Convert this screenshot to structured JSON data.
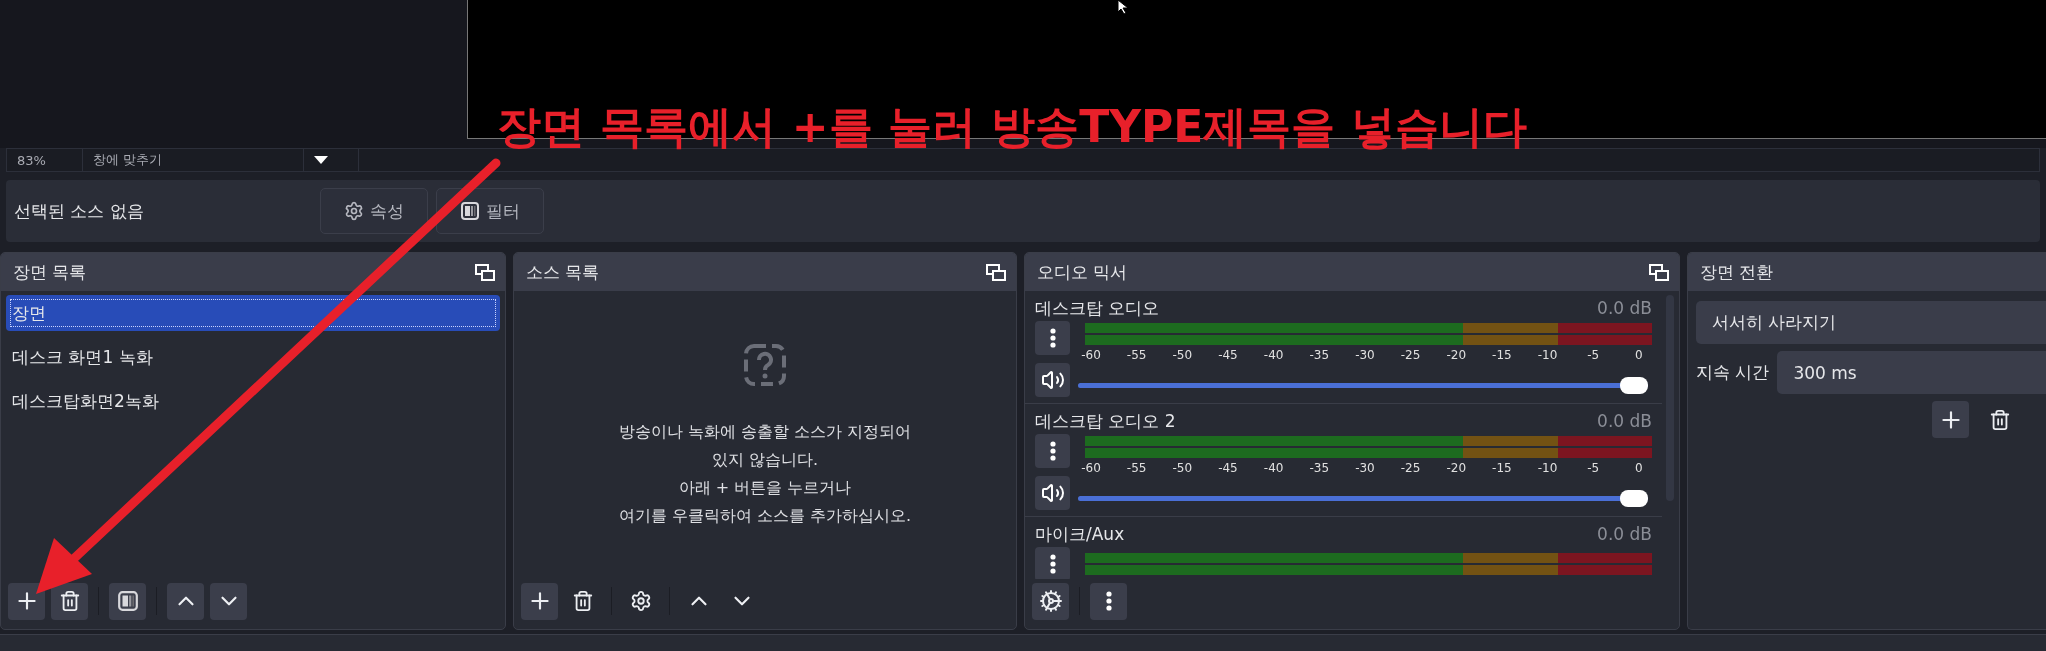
{
  "preview": {
    "zoom": "83%",
    "scale_mode": "창에 맞추기"
  },
  "annotation": {
    "text": "장면 목록에서 +를 눌러 방송TYPE제목을 넣습니다"
  },
  "context_bar": {
    "status": "선택된 소스 없음",
    "buttons": [
      "속성",
      "필터"
    ]
  },
  "scenes": {
    "title": "장면 목록",
    "items": [
      {
        "label": "장면",
        "selected": true
      },
      {
        "label": "데스크 화면1 녹화",
        "selected": false
      },
      {
        "label": "데스크탑화면2녹화",
        "selected": false
      }
    ]
  },
  "sources": {
    "title": "소스 목록",
    "empty_lines": [
      "방송이나 녹화에 송출할 소스가 지정되어",
      "있지 않습니다.",
      "아래 + 버튼을 누르거나",
      "여기를 우클릭하여 소스를 추가하십시오."
    ]
  },
  "audio_mixer": {
    "title": "오디오 믹서",
    "channels": [
      {
        "name": "데스크탑 오디오",
        "reading": "0.0 dB",
        "scale": [
          "-60",
          "-55",
          "-50",
          "-45",
          "-40",
          "-35",
          "-30",
          "-25",
          "-20",
          "-15",
          "-10",
          "-5",
          "0"
        ],
        "level": 1
      },
      {
        "name": "데스크탑 오디오 2",
        "reading": "0.0 dB",
        "scale": [
          "-60",
          "-55",
          "-50",
          "-45",
          "-40",
          "-35",
          "-30",
          "-25",
          "-20",
          "-15",
          "-10",
          "-5",
          "0"
        ],
        "level": 1
      },
      {
        "name": "마이크/Aux",
        "reading": "0.0 dB"
      }
    ]
  },
  "transitions": {
    "title": "장면 전환",
    "transition": "서서히 사라지기",
    "duration_label": "지속 시간",
    "duration": "300 ms"
  }
}
